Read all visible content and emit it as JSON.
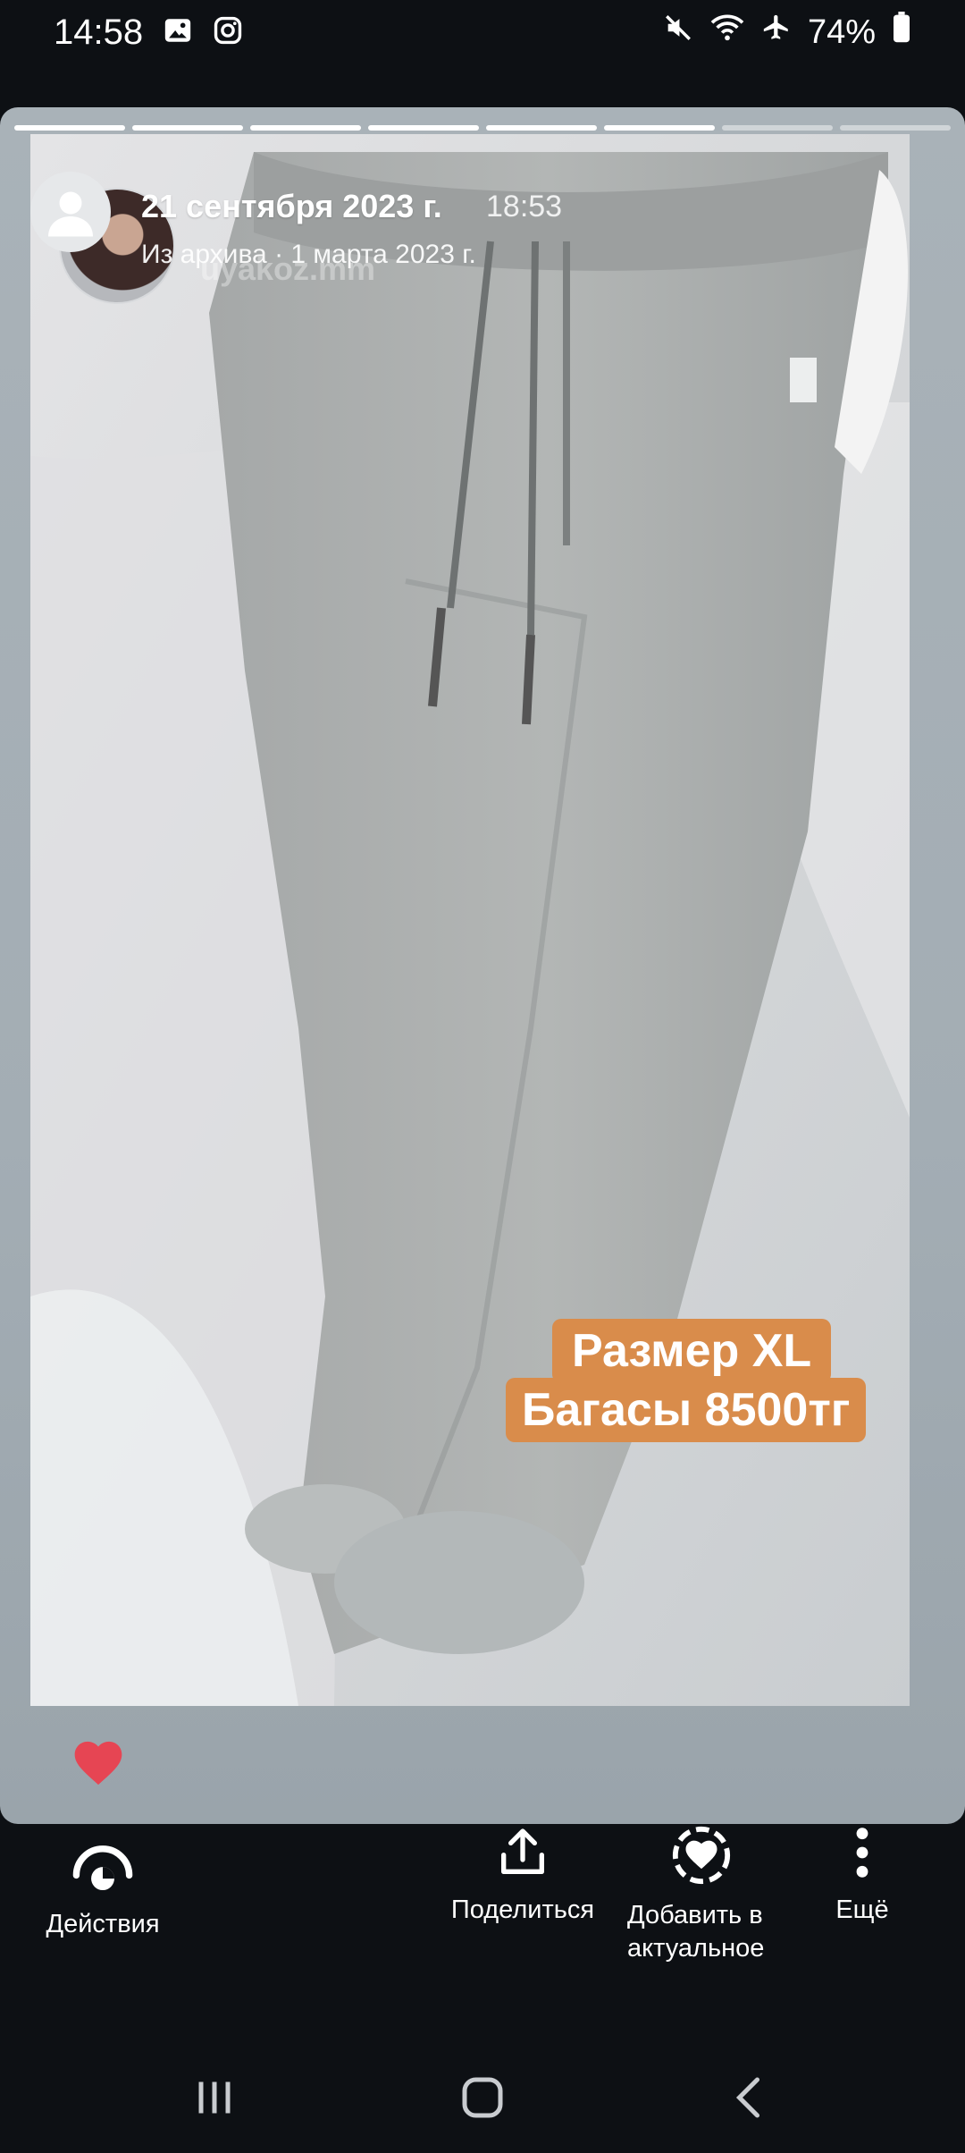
{
  "status_bar": {
    "time": "14:58",
    "battery": "74%",
    "left_icons": [
      "gallery-icon",
      "instagram-icon"
    ],
    "right_icons": [
      "mute-icon",
      "wifi-icon",
      "airplane-icon",
      "battery-icon"
    ]
  },
  "story": {
    "progress": {
      "segments": 8,
      "completed": 6
    },
    "date": "21 сентября 2023 г.",
    "time": "18:53",
    "subtitle": "Из архива · 1 марта 2023 г.",
    "watermark": "uyakoz.mm",
    "price_line_1": "Размер XL",
    "price_line_2": "Багасы 8500тг",
    "liked": true,
    "colors": {
      "heart": "#e64553",
      "price_tag": "#d98c4b"
    }
  },
  "actions": {
    "activity": "Действия",
    "share": "Поделиться",
    "highlight": "Добавить в\nактуальное",
    "highlight_line1": "Добавить в",
    "highlight_line2": "актуальное",
    "more": "Ещё"
  },
  "nav": {
    "buttons": [
      "recents-icon",
      "home-icon",
      "back-icon"
    ]
  }
}
